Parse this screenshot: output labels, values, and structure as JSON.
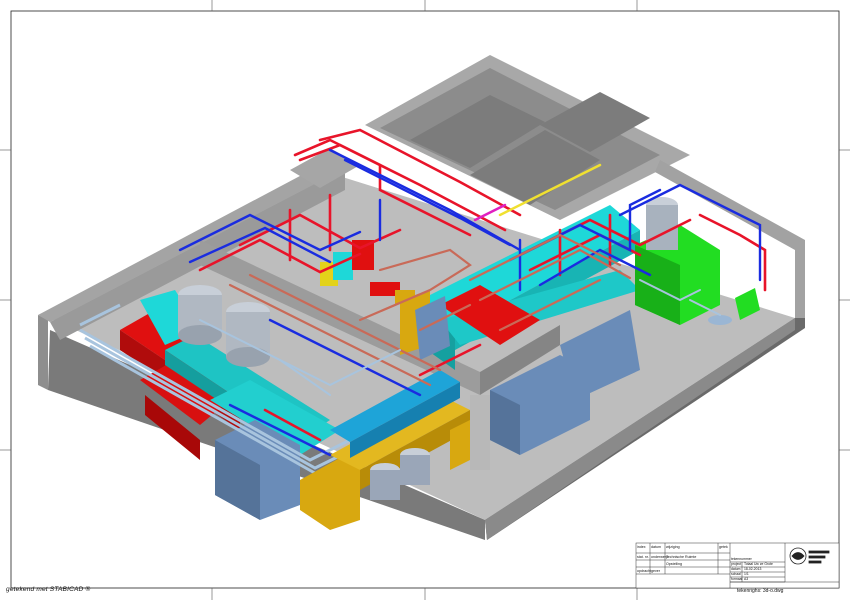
{
  "sheet": {
    "credit": "getekend met STABICAD ®",
    "sheet_name": "tekenrighs: 3d-o.dwg"
  },
  "title_block": {
    "rows": [
      {
        "a": "index",
        "b": "datum",
        "c": "wijziging",
        "d": "getek"
      },
      {
        "a": "stat. nr.",
        "b": "onderwerp",
        "c": "Technische Ruimte",
        "d": ""
      },
      {
        "a": "",
        "b": "",
        "c": "Opstelling",
        "d": ""
      },
      {
        "a": "opdrachtgever",
        "b": "",
        "c": "",
        "d": ""
      }
    ],
    "fields": [
      {
        "k": "tekennummer",
        "v": ""
      },
      {
        "k": "project",
        "v": "Totaal Uw ze Grote"
      },
      {
        "k": "datum",
        "v": "18-02-2013"
      },
      {
        "k": "schaal",
        "v": "1/1"
      },
      {
        "k": "formaat",
        "v": "A3"
      }
    ]
  },
  "colors": {
    "room_floor": "#c0c0c0",
    "room_wall_top": "#9e9e9e",
    "room_wall_inner": "#8a8a8a",
    "room_wall_outer": "#6e6e6e",
    "supply_pipe": "#e8142a",
    "return_pipe": "#1a2ce0",
    "copper_pipe": "#c96a58",
    "steel_pipe": "#a8c4de",
    "air_duct_cyan": "#1ed8d8",
    "air_duct_red": "#e01010",
    "air_duct_gold": "#d8a810",
    "unit_blue": "#6a8cb8",
    "unit_green": "#22dd22",
    "tank": "#b4bcc6",
    "yellow_pipe": "#f0e030",
    "magenta_pipe": "#e020c0"
  }
}
